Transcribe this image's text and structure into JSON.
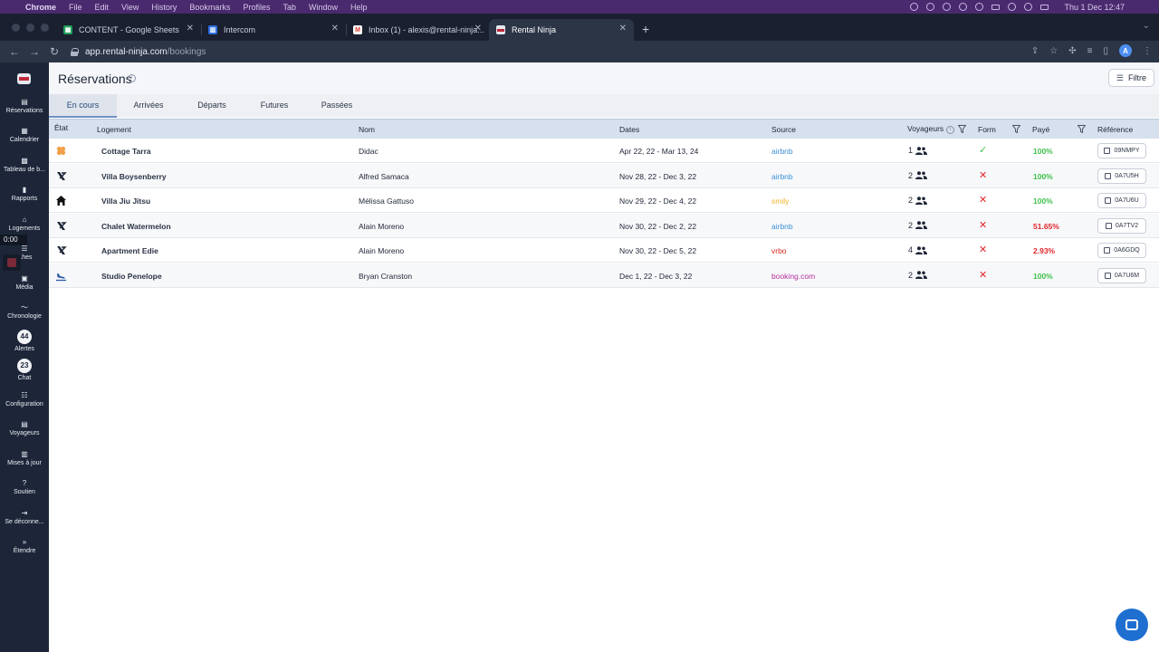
{
  "os_menu": {
    "app": "Chrome",
    "items": [
      "File",
      "Edit",
      "View",
      "History",
      "Bookmarks",
      "Profiles",
      "Tab",
      "Window",
      "Help"
    ],
    "clock": "Thu 1 Dec 12:47"
  },
  "browser": {
    "tabs": [
      {
        "title": "CONTENT - Google Sheets",
        "fav": "G",
        "fav_color": "#1e9e58"
      },
      {
        "title": "Intercom",
        "fav": "I",
        "fav_color": "#2d6fe0"
      },
      {
        "title": "Inbox (1) - alexis@rental-ninja...",
        "fav": "M",
        "fav_color": "#d93a2c"
      },
      {
        "title": "Rental Ninja",
        "fav": "R",
        "fav_color": "#c0283a"
      }
    ],
    "url_host": "app.rental-ninja.com",
    "url_path": "/bookings",
    "profile_initial": "A"
  },
  "sidebar": {
    "timer": "0:00",
    "items": [
      {
        "label": "Réservations",
        "icon": "bookings-icon",
        "glyph": "▤"
      },
      {
        "label": "Calendrier",
        "icon": "calendar-icon",
        "glyph": "▦"
      },
      {
        "label": "Tableau de b...",
        "icon": "dashboard-icon",
        "glyph": "▩"
      },
      {
        "label": "Rapports",
        "icon": "reports-icon",
        "glyph": "▮"
      },
      {
        "label": "Logements",
        "icon": "home-icon",
        "glyph": "⌂"
      },
      {
        "label": "...hes",
        "icon": "tasks-icon",
        "glyph": "☰"
      },
      {
        "label": "Média",
        "icon": "media-icon",
        "glyph": "▣"
      },
      {
        "label": "Chronologie",
        "icon": "timeline-icon",
        "glyph": "〜"
      },
      {
        "label": "Alertes",
        "badge": "44"
      },
      {
        "label": "Chat",
        "badge": "23"
      },
      {
        "label": "Configuration",
        "icon": "settings-icon",
        "glyph": "☷"
      },
      {
        "label": "Voyageurs",
        "icon": "guests-icon",
        "glyph": "▤"
      },
      {
        "label": "Mises à jour",
        "icon": "updates-icon",
        "glyph": "▥"
      },
      {
        "label": "Soutien",
        "icon": "support-icon",
        "glyph": "?"
      },
      {
        "label": "Se déconne...",
        "icon": "logout-icon",
        "glyph": "⇥"
      },
      {
        "label": "Étendre",
        "icon": "expand-icon",
        "glyph": "»"
      }
    ]
  },
  "header": {
    "title": "Réservations",
    "filter_label": "Filtre"
  },
  "view_tabs": [
    "En cours",
    "Arrivées",
    "Départs",
    "Futures",
    "Passées"
  ],
  "table": {
    "columns": {
      "state": "État",
      "listing": "Logement",
      "name": "Nom",
      "dates": "Dates",
      "source": "Source",
      "guests": "Voyageurs",
      "form": "Form",
      "paid": "Payé",
      "reference": "Référence"
    },
    "rows": [
      {
        "state": "checkin-in-progress",
        "listing": "Cottage Tarra",
        "name": "Didac",
        "dates": "Apr 22, 22 - Mar 13, 24",
        "source": "airbnb",
        "source_color": "#3b8fd6",
        "guests": "1",
        "form": "ok",
        "paid": "100%",
        "paid_color": "#3fbf4b",
        "ref": "09NMPY"
      },
      {
        "state": "in-stay",
        "listing": "Villa Boysenberry",
        "name": "Alfred Samaca",
        "dates": "Nov 28, 22 - Dec 3, 22",
        "source": "airbnb",
        "source_color": "#3b8fd6",
        "guests": "2",
        "form": "missing",
        "paid": "100%",
        "paid_color": "#3fbf4b",
        "ref": "0A7U5H"
      },
      {
        "state": "home",
        "listing": "Villa Jiu Jitsu",
        "name": "Mélissa Gattuso",
        "dates": "Nov 29, 22 - Dec 4, 22",
        "source": "smily",
        "source_color": "#f2b227",
        "guests": "2",
        "form": "missing",
        "paid": "100%",
        "paid_color": "#3fbf4b",
        "ref": "0A7U6U"
      },
      {
        "state": "in-stay",
        "listing": "Chalet Watermelon",
        "name": "Alain Moreno",
        "dates": "Nov 30, 22 - Dec 2, 22",
        "source": "airbnb",
        "source_color": "#3b8fd6",
        "guests": "2",
        "form": "missing",
        "paid": "51.65%",
        "paid_color": "#e0262b",
        "ref": "0A7TV2"
      },
      {
        "state": "in-stay",
        "listing": "Apartment Edie",
        "name": "Alain Moreno",
        "dates": "Nov 30, 22 - Dec 5, 22",
        "source": "vrbo",
        "source_color": "#d9261c",
        "guests": "4",
        "form": "missing",
        "paid": "2.93%",
        "paid_color": "#e0262b",
        "ref": "0A6GDQ"
      },
      {
        "state": "arrival",
        "listing": "Studio Penelope",
        "name": "Bryan Cranston",
        "dates": "Dec 1, 22 - Dec 3, 22",
        "source": "booking.com",
        "source_color": "#b72f9e",
        "guests": "2",
        "form": "missing",
        "paid": "100%",
        "paid_color": "#3fbf4b",
        "ref": "0A7U6M"
      }
    ]
  }
}
